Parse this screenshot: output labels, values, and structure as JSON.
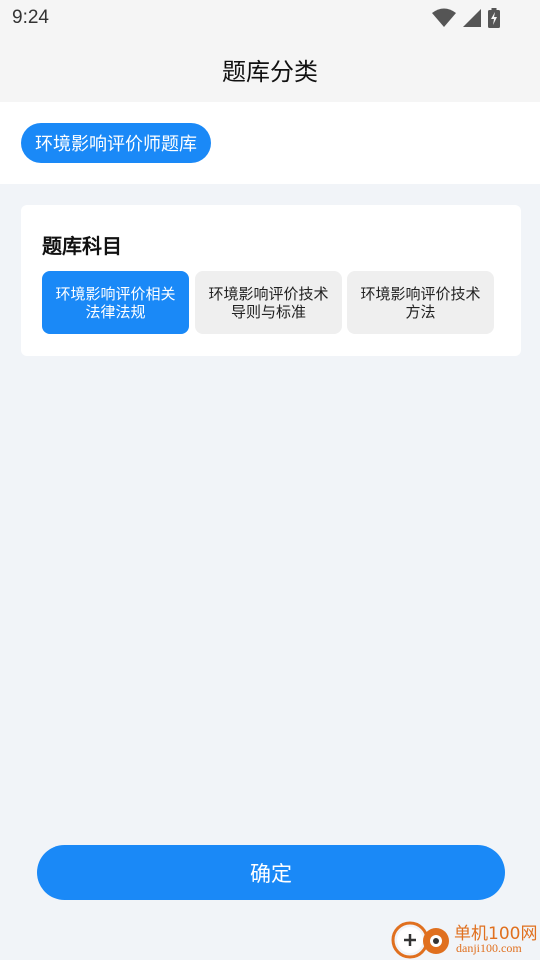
{
  "status_bar": {
    "time": "9:24",
    "icons": [
      "wifi-icon",
      "signal-icon",
      "battery-icon"
    ]
  },
  "header": {
    "title": "题库分类"
  },
  "category": {
    "selected_label": "环境影响评价师题库"
  },
  "subjects_card": {
    "title": "题库科目",
    "items": [
      {
        "label_line1": "环境影响评价相关",
        "label_line2": "法律法规",
        "selected": true
      },
      {
        "label_line1": "环境影响评价技术",
        "label_line2": "导则与标准",
        "selected": false
      },
      {
        "label_line1": "环境影响评价技术",
        "label_line2": "方法",
        "selected": false
      }
    ]
  },
  "footer": {
    "confirm_label": "确定"
  },
  "watermark": {
    "brand": "单机100网",
    "domain": "danji100.com"
  },
  "colors": {
    "accent": "#1a89f7",
    "page_bg": "#f1f4f8",
    "chip_inactive_bg": "#efefef",
    "watermark": "#e0701f"
  }
}
